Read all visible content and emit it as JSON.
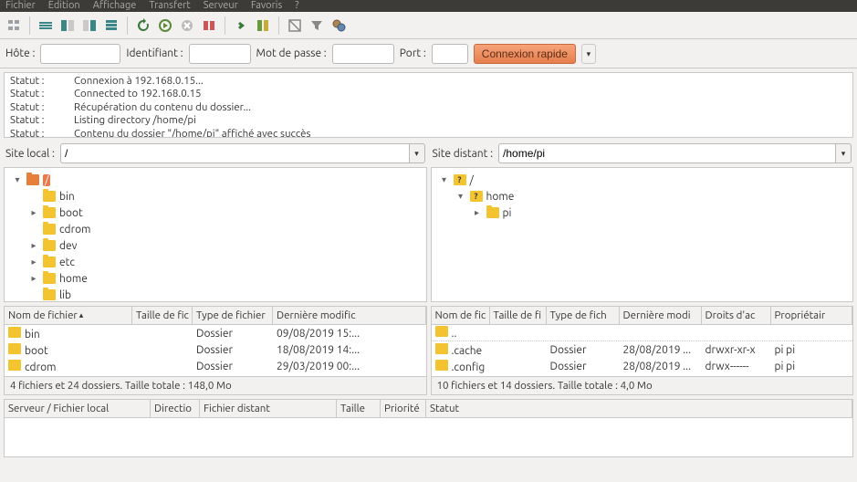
{
  "menu": {
    "items": [
      "Fichier",
      "Édition",
      "Affichage",
      "Transfert",
      "Serveur",
      "Favoris",
      "?"
    ]
  },
  "quick": {
    "host_label": "Hôte :",
    "user_label": "Identifiant :",
    "pass_label": "Mot de passe :",
    "port_label": "Port :",
    "connect_label": "Connexion rapide",
    "host": "",
    "user": "",
    "pass": "",
    "port": ""
  },
  "log": [
    {
      "label": "Statut :",
      "msg": "Connexion à 192.168.0.15..."
    },
    {
      "label": "Statut :",
      "msg": "Connected to 192.168.0.15"
    },
    {
      "label": "Statut :",
      "msg": "Récupération du contenu du dossier..."
    },
    {
      "label": "Statut :",
      "msg": "Listing directory /home/pi"
    },
    {
      "label": "Statut :",
      "msg": "Contenu du dossier \"/home/pi\" affiché avec succès"
    }
  ],
  "local": {
    "label": "Site local :",
    "path": "/",
    "tree": [
      {
        "indent": 0,
        "tw": "▾",
        "ico": "folder-o",
        "name": "/",
        "sel": true
      },
      {
        "indent": 1,
        "tw": "",
        "ico": "folder-y",
        "name": "bin"
      },
      {
        "indent": 1,
        "tw": "▸",
        "ico": "folder-y",
        "name": "boot"
      },
      {
        "indent": 1,
        "tw": "",
        "ico": "folder-y",
        "name": "cdrom"
      },
      {
        "indent": 1,
        "tw": "▸",
        "ico": "folder-y",
        "name": "dev"
      },
      {
        "indent": 1,
        "tw": "▸",
        "ico": "folder-y",
        "name": "etc"
      },
      {
        "indent": 1,
        "tw": "▸",
        "ico": "folder-y",
        "name": "home"
      },
      {
        "indent": 1,
        "tw": "",
        "ico": "folder-y",
        "name": "lib"
      }
    ],
    "cols": {
      "name": "Nom de fichier",
      "size": "Taille de fic",
      "type": "Type de fichier",
      "mod": "Dernière modific"
    },
    "rows": [
      {
        "name": "bin",
        "type": "Dossier",
        "mod": "09/08/2019 15:..."
      },
      {
        "name": "boot",
        "type": "Dossier",
        "mod": "18/08/2019 14:..."
      },
      {
        "name": "cdrom",
        "type": "Dossier",
        "mod": "29/03/2019 00:..."
      }
    ],
    "summary": "4 fichiers et 24 dossiers. Taille totale : 148,0 Mo"
  },
  "remote": {
    "label": "Site distant :",
    "path": "/home/pi",
    "tree": [
      {
        "indent": 0,
        "tw": "▾",
        "ico": "folder-q",
        "name": "/"
      },
      {
        "indent": 1,
        "tw": "▾",
        "ico": "folder-q",
        "name": "home"
      },
      {
        "indent": 2,
        "tw": "▸",
        "ico": "folder-y",
        "name": "pi"
      }
    ],
    "cols": {
      "name": "Nom de fic",
      "size": "Taille de fi",
      "type": "Type de fich",
      "mod": "Dernière modi",
      "perm": "Droits d'ac",
      "owner": "Propriétair"
    },
    "up_label": "..",
    "rows": [
      {
        "name": ".cache",
        "type": "Dossier",
        "mod": "28/08/2019 ...",
        "perm": "drwxr-xr-x",
        "owner": "pi pi"
      },
      {
        "name": ".config",
        "type": "Dossier",
        "mod": "28/08/2019 ...",
        "perm": "drwx------",
        "owner": "pi pi"
      }
    ],
    "summary": "10 fichiers et 14 dossiers. Taille totale : 4,0 Mo"
  },
  "transfer": {
    "cols": {
      "file": "Serveur / Fichier local",
      "dir": "Directio",
      "remote": "Fichier distant",
      "size": "Taille",
      "prio": "Priorité",
      "status": "Statut"
    }
  }
}
